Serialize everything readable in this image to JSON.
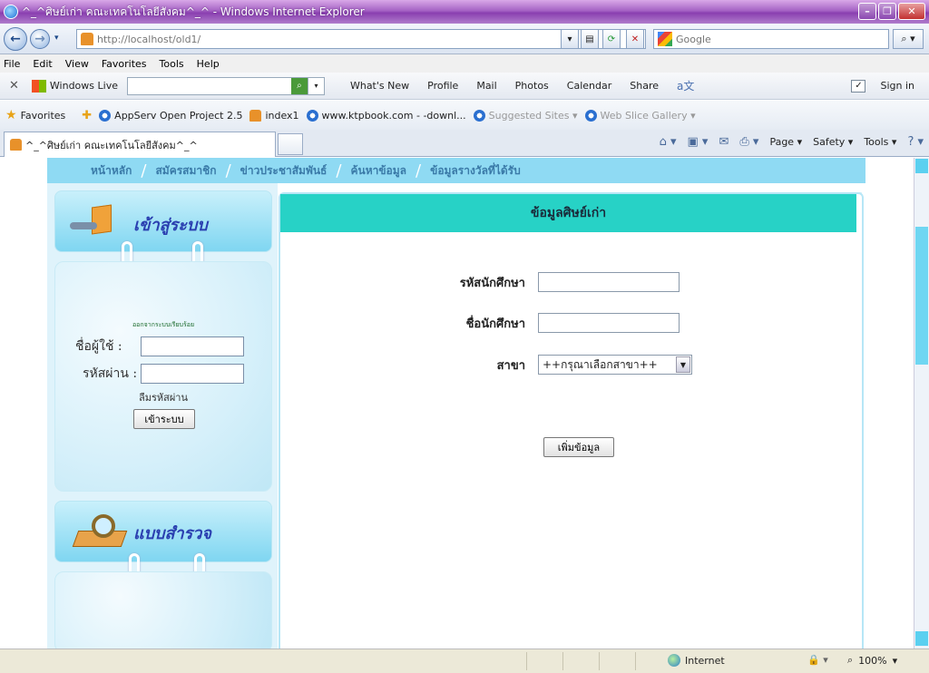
{
  "window": {
    "title": "^_^ศิษย์เก่า คณะเทคโนโลยีสังคม^_^ - Windows Internet Explorer",
    "minimize_glyph": "–",
    "restore_glyph": "❐",
    "close_glyph": "✕"
  },
  "address_bar": {
    "back_glyph": "←",
    "forward_glyph": "→",
    "dropdown_glyph": "▾",
    "url": "http://localhost/old1/",
    "refresh_glyph": "⟳",
    "stop_glyph": "✕",
    "compat_glyph": "▤",
    "search_placeholder": "Google",
    "search_go_glyph": "⌕ ▾"
  },
  "menu": {
    "items": [
      "File",
      "Edit",
      "View",
      "Favorites",
      "Tools",
      "Help"
    ]
  },
  "live_toolbar": {
    "close_glyph": "✕",
    "brand": "Windows Live",
    "search_go_glyph": "⌕",
    "links": [
      "What's New",
      "Profile",
      "Mail",
      "Photos",
      "Calendar",
      "Share"
    ],
    "translate_glyph": "a文",
    "signin": "Sign in",
    "check_glyph": "✓"
  },
  "favorites_bar": {
    "label": "Favorites",
    "items": [
      {
        "label": "AppServ Open Project 2.5",
        "icon": "house-page-icon",
        "muted": false
      },
      {
        "label": "index1",
        "icon": "house-page-icon",
        "muted": false
      },
      {
        "label": "www.ktpbook.com - -downl...",
        "icon": "ie-page-icon",
        "muted": false
      },
      {
        "label": "Suggested Sites ▾",
        "icon": "ie-page-icon",
        "muted": true
      },
      {
        "label": "Web Slice Gallery ▾",
        "icon": "ie-page-icon",
        "muted": true
      }
    ]
  },
  "tab": {
    "label": "^_^ศิษย์เก่า คณะเทคโนโลยีสังคม^_^"
  },
  "command_bar": {
    "items": [
      "Page ▾",
      "Safety ▾",
      "Tools ▾"
    ],
    "home_glyph": "⌂ ▾",
    "feeds_glyph": "▣ ▾",
    "mail_glyph": "✉",
    "print_glyph": "⎙ ▾",
    "help_glyph": "? ▾"
  },
  "site": {
    "nav": [
      "หน้าหลัก",
      "สมัครสมาชิก",
      "ข่าวประชาสัมพันธ์",
      "ค้นหาข้อมูล",
      "ข้อมูลรางวัลที่ได้รับ"
    ],
    "nav_separator": "/",
    "login_panel": {
      "title": "เข้าสู่ระบบ",
      "note": "ออกจากระบบเรียบร้อย",
      "username_label": "ชื่อผู้ใช้ :",
      "password_label": "รหัสผ่าน :",
      "forgot_label": "ลืมรหัสผ่าน",
      "login_button": "เข้าระบบ"
    },
    "survey_panel": {
      "title": "แบบสำรวจ"
    },
    "form": {
      "heading": "ข้อมูลศิษย์เก่า",
      "student_id_label": "รหัสนักศึกษา",
      "student_name_label": "ชื่อนักศึกษา",
      "major_label": "สาขา",
      "major_selected": "++กรุณาเลือกสาขา++",
      "select_arrow_glyph": "▼",
      "add_button": "เพิ่มข้อมูล"
    }
  },
  "status_bar": {
    "zone": "Internet",
    "protect_glyph": "🔒 ▾",
    "zoom": "100%",
    "zoom_glyph": "⌕",
    "zoom_dropdown_glyph": "▾"
  },
  "colors": {
    "titlebar": "#a563c4",
    "site_nav": "#8fdaf3",
    "form_header": "#27d2c6",
    "sidebar_panel": "#7fd6f1",
    "panel_title": "#2a3fb0"
  }
}
